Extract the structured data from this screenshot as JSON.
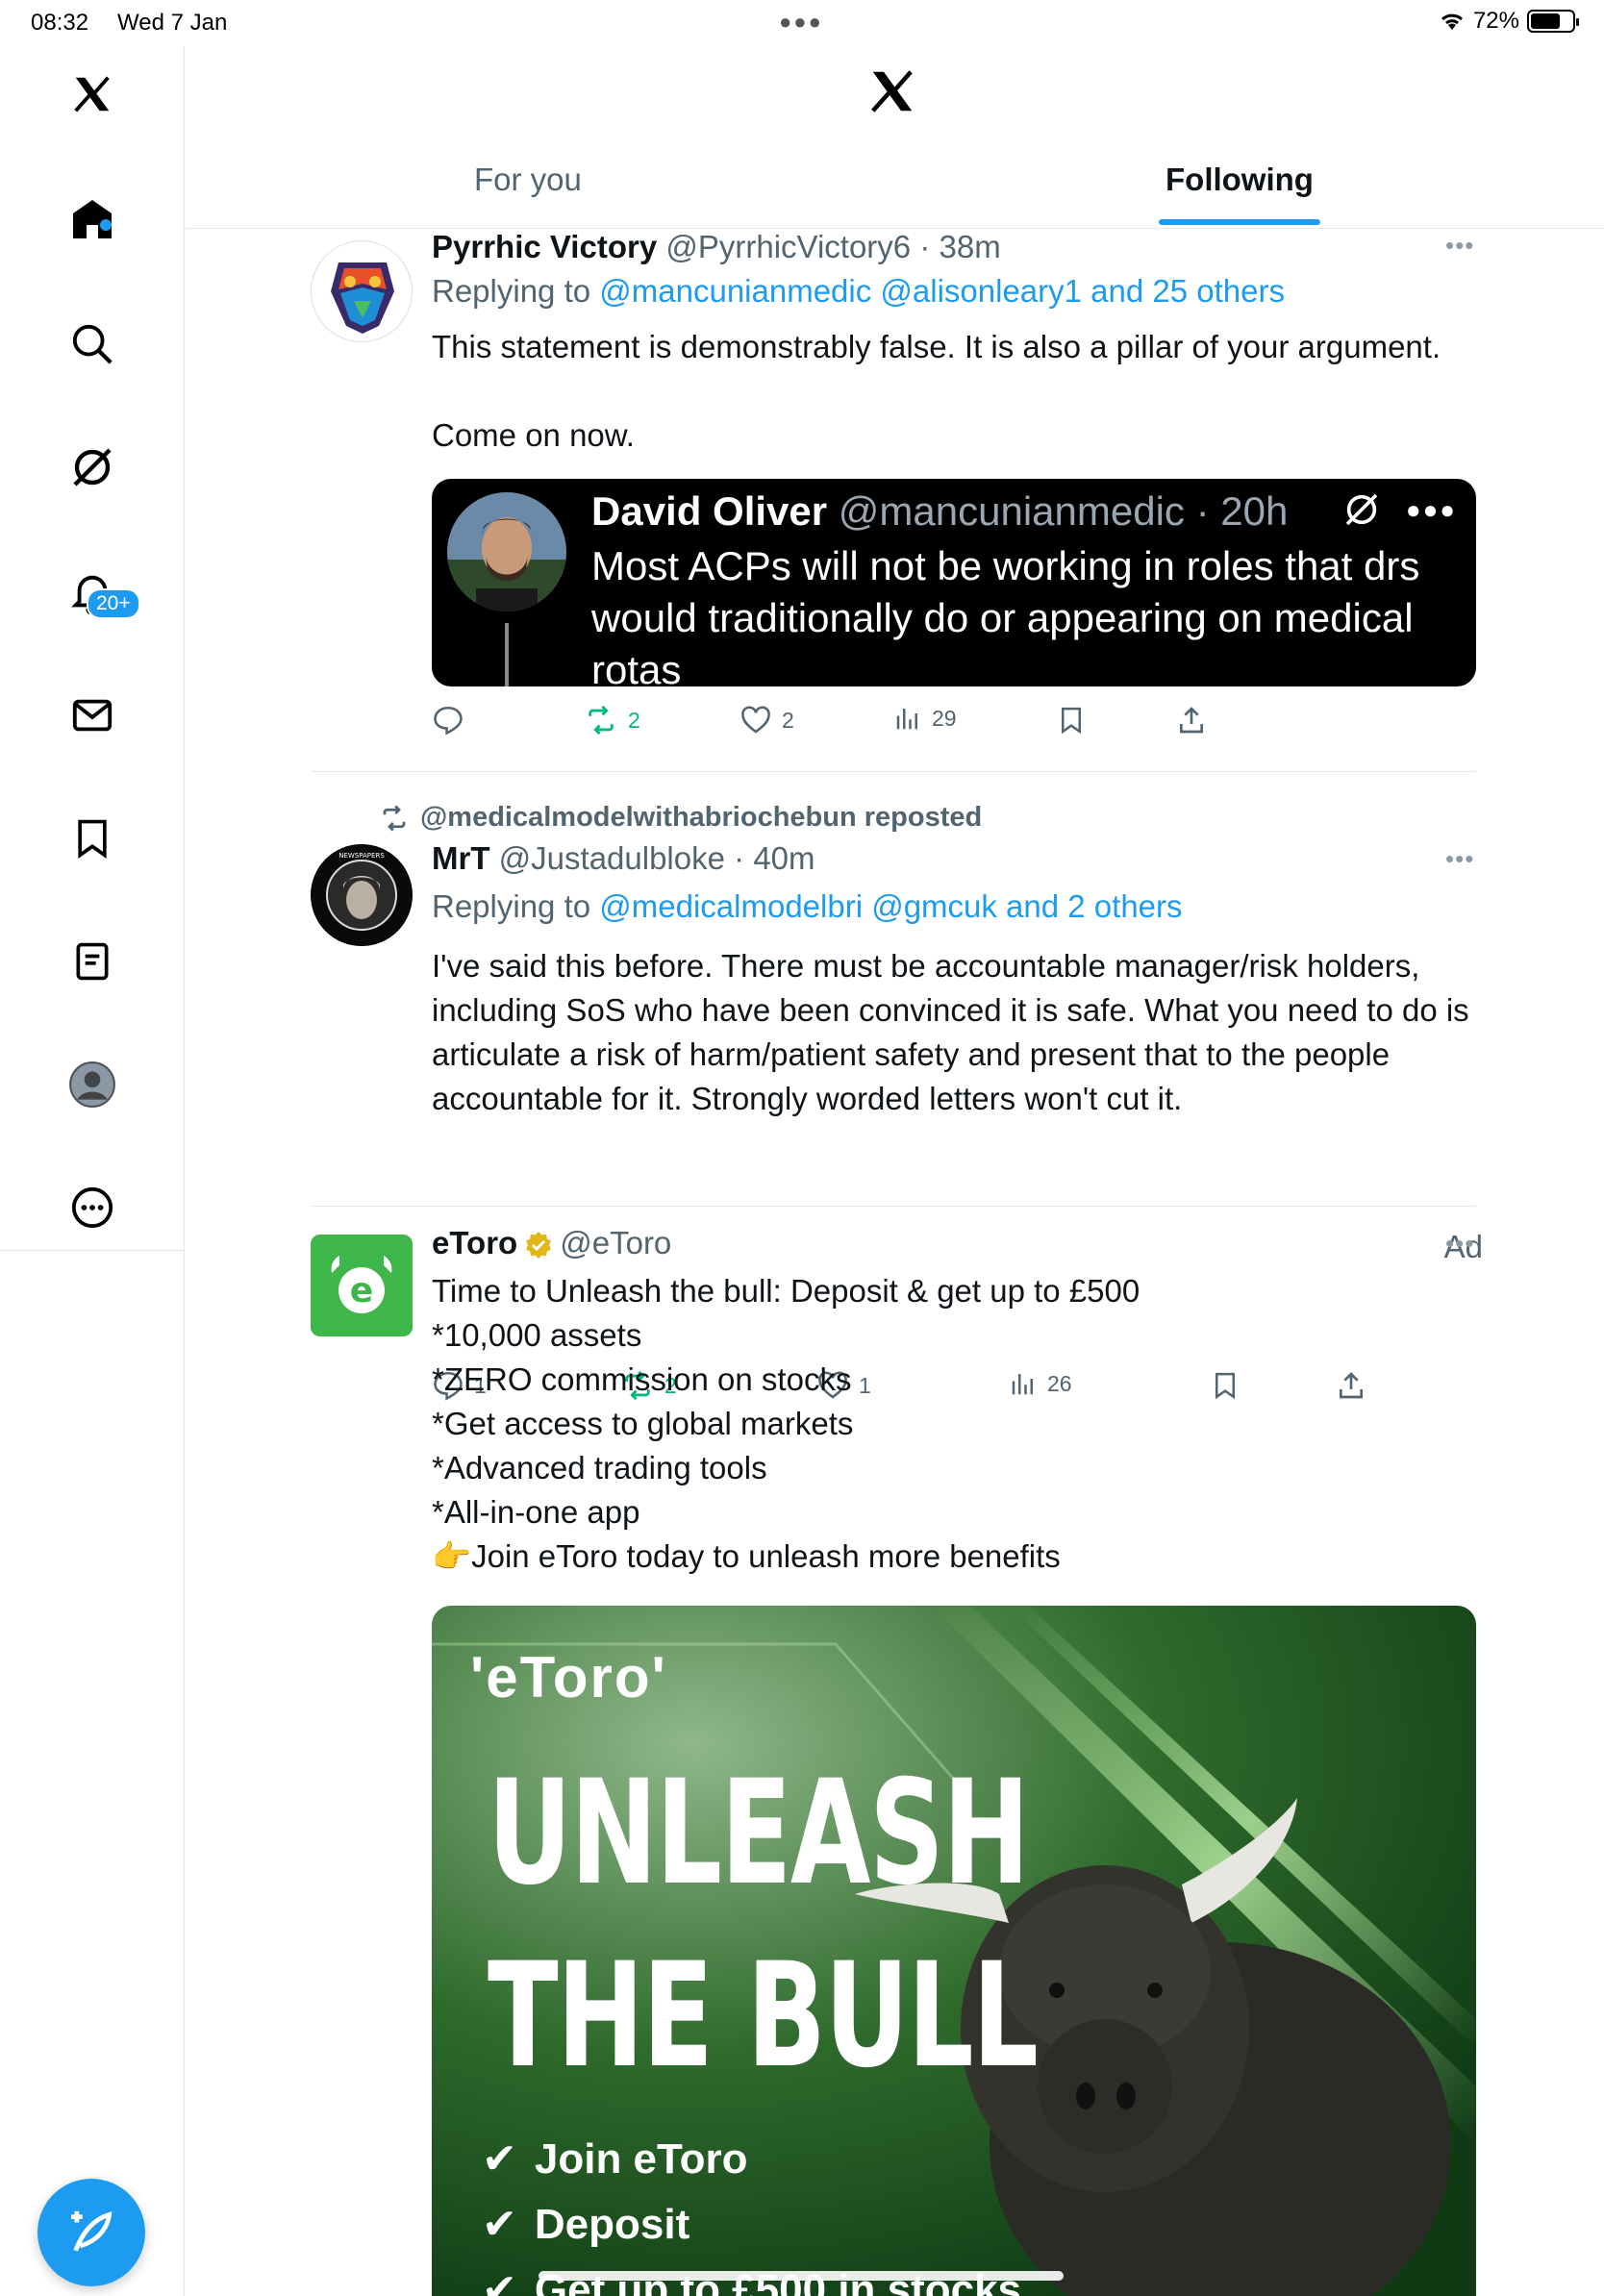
{
  "status_bar": {
    "time": "08:32",
    "date": "Wed 7 Jan",
    "battery": "72%",
    "battery_level": 0.72
  },
  "sidebar": {
    "items": [
      "x-logo",
      "home-icon",
      "search-icon",
      "grok-icon",
      "notifications-icon",
      "messages-icon",
      "bookmarks-icon",
      "lists-icon",
      "profile-icon",
      "more-icon"
    ],
    "notification_count": "20+"
  },
  "header": {
    "tabs": [
      {
        "label": "For you"
      },
      {
        "label": "Following"
      }
    ],
    "active_tab": "Following"
  },
  "tweets": [
    {
      "name": "Pyrrhic Victory",
      "handle": "@PyrrhicVictory6",
      "time": "38m",
      "replying_prefix": "Replying to ",
      "replying_to": "@mancunianmedic @alisonleary1 and 25 others",
      "text": "This statement is demonstrably false. It is also a pillar of your argument.\n\nCome on now.",
      "quote": {
        "name": "David Oliver",
        "handle": "@mancunianmedic",
        "time": "20h",
        "text": "Most ACPs will not be working in roles that drs would traditionally do or appearing on medical rotas"
      },
      "stats": {
        "replies": "",
        "reposts": "2",
        "likes": "2",
        "views": "29"
      }
    },
    {
      "repost_by": "@medicalmodelwithabriochebun reposted",
      "name": "MrT",
      "handle": "@Justadulbloke",
      "time": "40m",
      "replying_prefix": "Replying to ",
      "replying_to": "@medicalmodelbri @gmcuk and 2 others",
      "text": "I've said this before.  There must be accountable manager/risk holders, including SoS who have been convinced it is safe.  What you need to do is articulate a risk of harm/patient safety and present that to the people accountable for it. Strongly worded letters won't cut it.",
      "stats": {
        "replies": "1",
        "reposts": "2",
        "likes": "1",
        "views": "26"
      }
    },
    {
      "name": "eToro",
      "handle": "@eToro",
      "ad_label": "Ad",
      "text": "Time to Unleash the bull: Deposit & get up to £500\n*10,000 assets\n*ZERO commission on stocks\n*Get access to global markets\n*Advanced trading tools\n*All-in-one app\n👉Join eToro today to unleash more benefits",
      "ad_image": {
        "logo": "'eToro'",
        "headline_1": "UNLEASH",
        "headline_2": "THE BULL",
        "checks": [
          "Join eToro",
          "Deposit",
          "Get up to £500 in stocks"
        ]
      }
    }
  ],
  "colors": {
    "accent": "#1d9bf0",
    "repost": "#00ba7c",
    "etoro_green": "#3fb64a"
  }
}
